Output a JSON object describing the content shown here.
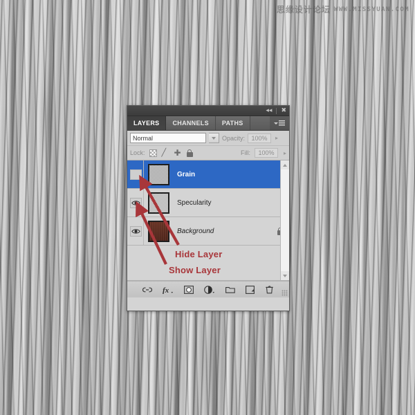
{
  "watermark": {
    "chinese": "思缘设计论坛",
    "url": "WWW.MISSYUAN.COM"
  },
  "panel": {
    "titlebar": {
      "collapse_icon": "collapse-double-arrow",
      "close_icon": "close-x"
    },
    "tabs": [
      {
        "label": "LAYERS",
        "active": true
      },
      {
        "label": "CHANNELS",
        "active": false
      },
      {
        "label": "PATHS",
        "active": false
      }
    ],
    "menu_icon": "panel-menu-icon",
    "blend": {
      "value": "Normal",
      "opacity_label": "Opacity:",
      "opacity_value": "100%"
    },
    "lock": {
      "label": "Lock:",
      "icons": [
        "transparency-checker-icon",
        "brush-icon",
        "move-icon",
        "lock-icon"
      ],
      "fill_label": "Fill:",
      "fill_value": "100%"
    },
    "layers": [
      {
        "name": "Grain",
        "visible": false,
        "selected": true,
        "italic": false,
        "locked": false,
        "thumb": "noise"
      },
      {
        "name": "Specularity",
        "visible": true,
        "selected": false,
        "italic": false,
        "locked": false,
        "thumb": "noise2"
      },
      {
        "name": "Background",
        "visible": true,
        "selected": false,
        "italic": true,
        "locked": true,
        "thumb": "brown"
      }
    ],
    "footer_icons": [
      "link-layers-icon",
      "layer-style-fx-icon",
      "layer-mask-icon",
      "adjustment-layer-icon",
      "new-group-icon",
      "new-layer-icon",
      "delete-layer-icon"
    ]
  },
  "annotations": {
    "hide_layer": "Hide Layer",
    "show_layer": "Show Layer",
    "color": "#a8363a"
  }
}
